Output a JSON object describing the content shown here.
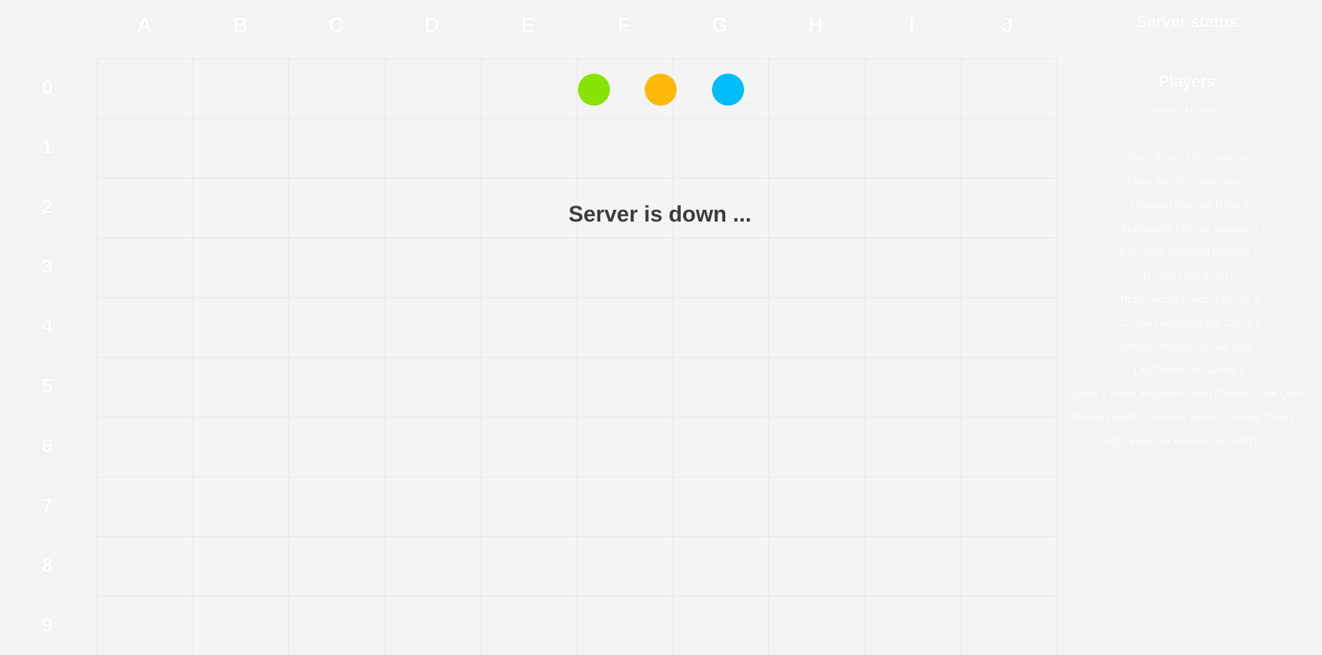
{
  "board": {
    "columns": [
      "A",
      "B",
      "C",
      "D",
      "E",
      "F",
      "G",
      "H",
      "I",
      "J"
    ],
    "rows": [
      "0",
      "1",
      "2",
      "3",
      "4",
      "5",
      "6",
      "7",
      "8",
      "9"
    ],
    "tokens": [
      {
        "name": "green-token",
        "color": "#88e204"
      },
      {
        "name": "orange-token",
        "color": "#ffb906"
      },
      {
        "name": "blue-token",
        "color": "#00bcf9"
      }
    ],
    "message": "Server is down ..."
  },
  "sidebar": {
    "status_title": "Server status:",
    "status_value": "",
    "players_title": "Players:",
    "players": [
      "Broker Horses 0",
      "",
      "Fund Raiser Mini Donkey 0",
      "Executive Assistant Dogs 0",
      "Litigation Attorney Rhea 0",
      "Multimedia Director Vaquita 0",
      "Executive Assistant Butterfly 0",
      "Dentist Pronghorn 0",
      "Professional Coach Tortoise 0",
      "Contract Administrator Cobra 0",
      "Service Manager Brown Bear 0",
      "Lab Technician Skinks 0",
      "Quality Control Inspector Small Clawed Asian Otter 0",
      "Mental Health Counselor White Crowned Gibbon 0",
      "Flight Engineer Bearded Butterflyfish 0"
    ]
  }
}
